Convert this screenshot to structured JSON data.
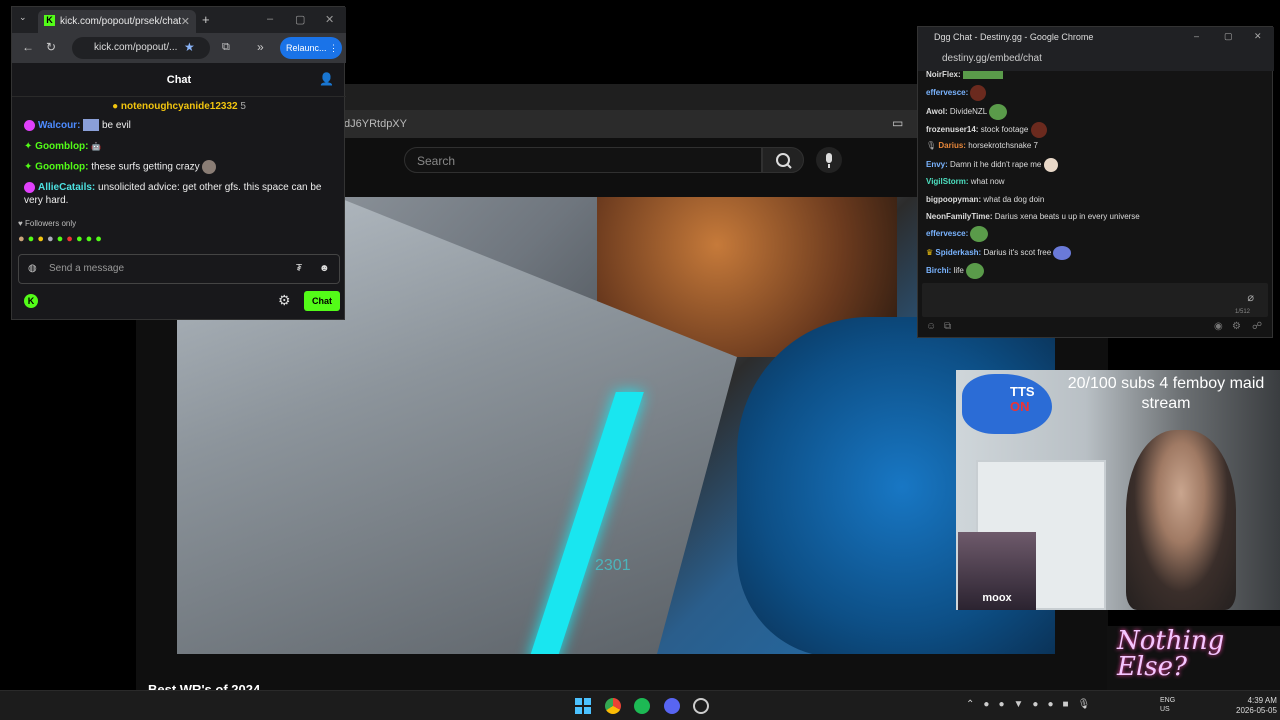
{
  "kick": {
    "tab_title": "kick.com/popout/prsek/chat",
    "url": "kick.com/popout/...",
    "relaunch_label": "Relaunc...",
    "header_title": "Chat",
    "pinned_user": "notenoughcyanide12332",
    "pinned_count": "5",
    "messages": [
      {
        "user": "Walcour:",
        "user_color": "#4d8bff",
        "text": "be evil"
      },
      {
        "user": "Goomblop:",
        "user_color": "#53fc18",
        "text": ""
      },
      {
        "user": "Goomblop:",
        "user_color": "#53fc18",
        "text": "these surfs getting crazy"
      },
      {
        "user": "AllieCatails:",
        "user_color": "#4de0e0",
        "text": "unsolicited advice: get other gfs. this space can be very hard."
      }
    ],
    "followers_label": "Followers only",
    "input_placeholder": "Send a message",
    "chat_button_label": "Chat"
  },
  "youtube": {
    "address": "dJ6YRtdpXY",
    "search_placeholder": "Search",
    "video_title": "Best WR's of 2024",
    "speed_readout": "2301"
  },
  "dgg": {
    "window_title": "Dgg Chat - Destiny.gg - Google Chrome",
    "url": "destiny.gg/embed/chat",
    "messages": [
      {
        "user": "NoirFlex:",
        "color": "#dddddd",
        "text": ""
      },
      {
        "user": "effervesce:",
        "color": "#7ab4ff",
        "text": ""
      },
      {
        "user": "Awol:",
        "color": "#dddddd",
        "text": "DivideNZL"
      },
      {
        "user": "frozenuser14:",
        "color": "#dddddd",
        "text": "stock footage"
      },
      {
        "user": "Darius:",
        "color": "#e8873a",
        "text": "horsekrotchsnake 7"
      },
      {
        "user": "Envy:",
        "color": "#7ab4ff",
        "text": "Damn it he didn't rape me"
      },
      {
        "user": "VigilStorm:",
        "color": "#4de0c0",
        "text": "what now"
      },
      {
        "user": "bigpoopyman:",
        "color": "#dddddd",
        "text": "what da dog doin"
      },
      {
        "user": "NeonFamilyTime:",
        "color": "#dddddd",
        "text": "Darius xena beats u up in every universe"
      },
      {
        "user": "effervesce:",
        "color": "#7ab4ff",
        "text": ""
      },
      {
        "user": "Spiderkash:",
        "color": "#7ab4ff",
        "text": "Darius it's scot free"
      },
      {
        "user": "Birchi:",
        "color": "#7ab4ff",
        "text": "life"
      }
    ],
    "char_count": "1/512"
  },
  "stream": {
    "subs_goal": "20/100 subs 4 femboy maid stream",
    "tts_label_1": "TTS",
    "tts_label_2": "ON",
    "cam_label": "moox",
    "overlay_text": "Nothing Else?"
  },
  "taskbar": {
    "lang": "ENG",
    "region": "US",
    "time": "4:39 AM",
    "date": "2026-05-05"
  }
}
